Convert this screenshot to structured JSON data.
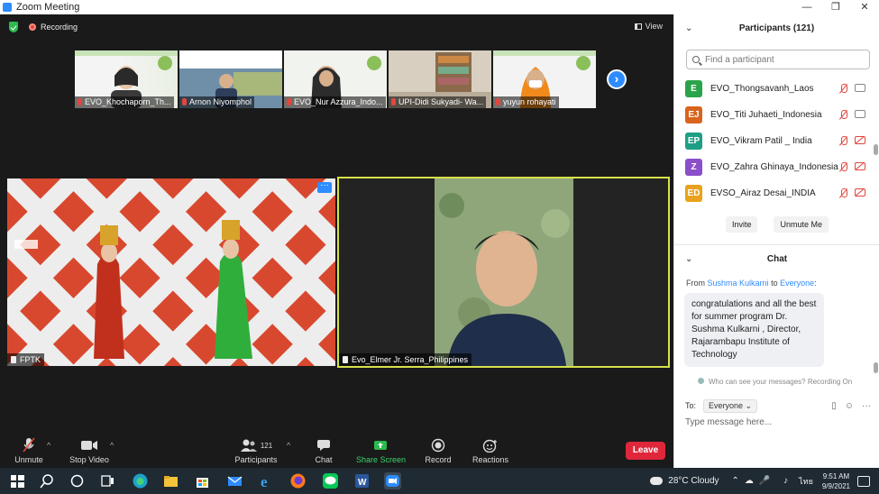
{
  "window": {
    "title": "Zoom Meeting",
    "minimize": "—",
    "restore": "❐",
    "close": "✕"
  },
  "topbar": {
    "recording": "Recording",
    "view": "View"
  },
  "gallery": [
    {
      "name": "EVO_Khochaporn_Th..."
    },
    {
      "name": "Arnon Niyomphol"
    },
    {
      "name": "EVO_Nur Azzura_Indo..."
    },
    {
      "name": "UPI-Didi Sukyadi- Wa..."
    },
    {
      "name": "yuyun rohayati"
    }
  ],
  "gallery_next": "›",
  "tiles": {
    "left_label": "FPTK",
    "right_label": "Evo_Elmer Jr. Serra_Philippines",
    "more": "···"
  },
  "toolbar": {
    "unmute": "Unmute",
    "stop_video": "Stop Video",
    "participants": "Participants",
    "participants_count": "121",
    "chat": "Chat",
    "share_screen": "Share Screen",
    "record": "Record",
    "reactions": "Reactions",
    "leave": "Leave",
    "caret": "^"
  },
  "participants_panel": {
    "title": "Participants (121)",
    "chevron": "⌄",
    "search_placeholder": "Find a participant",
    "items": [
      {
        "initials": "E",
        "name": "EVO_Thongsavanh_Laos",
        "color": "#2ba34a",
        "video": "on"
      },
      {
        "initials": "EJ",
        "name": "EVO_Titi Juhaeti_Indonesia",
        "color": "#d9641e",
        "video": "on"
      },
      {
        "initials": "EP",
        "name": "EVO_Vikram Patil _ India",
        "color": "#1f9e86",
        "video": "off"
      },
      {
        "initials": "Z",
        "name": "EVO_Zahra Ghinaya_Indonesia",
        "color": "#8a4fc9",
        "video": "off"
      },
      {
        "initials": "ED",
        "name": "EVSO_Airaz Desai_INDIA",
        "color": "#e9a21c",
        "video": "off"
      }
    ],
    "invite": "Invite",
    "unmute_me": "Unmute Me"
  },
  "chat_panel": {
    "title": "Chat",
    "from_prefix": "From",
    "sender": "Sushma Kulkarni",
    "to_word": "to",
    "recipient": "Everyone",
    "message": "congratulations and all the best for summer program Dr. Sushma Kulkarni , Director, Rajarambapu Institute of Technology",
    "who_can_see": "Who can see your messages? Recording On",
    "to_label": "To:",
    "to_value": "Everyone ⌄",
    "type_placeholder": "Type message here..."
  },
  "taskbar": {
    "weather": "28°C  Cloudy",
    "time": "9:51 AM",
    "date": "9/9/2021",
    "lang": "ไทย"
  }
}
